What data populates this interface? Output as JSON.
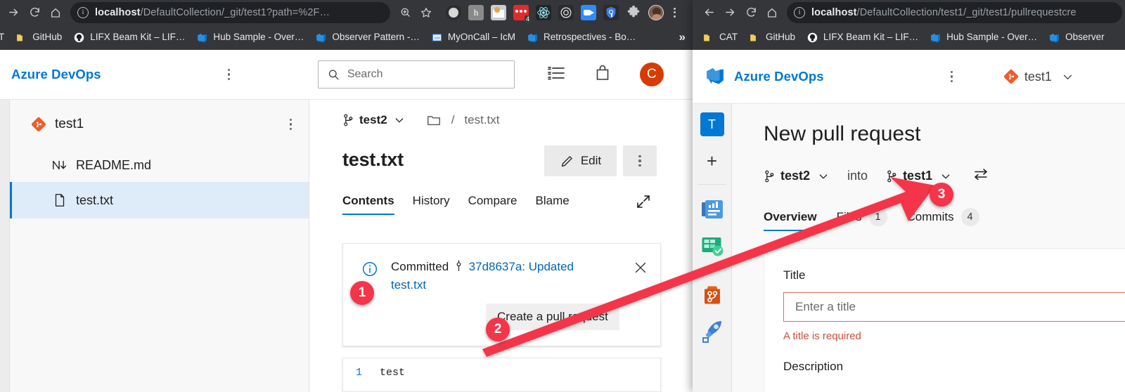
{
  "left_window": {
    "browser": {
      "nav": {
        "forward_icon": "arrow-right-icon",
        "reload_icon": "reload-icon",
        "home_icon": "home-icon"
      },
      "omnibox": {
        "info_icon": "site-info-icon",
        "url_host": "localhost",
        "url_path": "/DefaultCollection/_git/test1?path=%2F…",
        "zoom_icon": "zoom-in-icon",
        "bookmark_icon": "star-icon"
      },
      "extensions": [
        {
          "name": "grammar-extension-icon"
        },
        {
          "name": "honey-extension-icon"
        },
        {
          "name": "chrome-store-extension-icon"
        },
        {
          "name": "messaging-extension-icon",
          "badge": "4"
        },
        {
          "name": "react-devtools-extension-icon"
        },
        {
          "name": "target-extension-icon"
        },
        {
          "name": "video-extension-icon"
        },
        {
          "name": "password-extension-icon"
        },
        {
          "name": "puzzle-extensions-icon"
        }
      ],
      "profile_icon": "profile-avatar-icon",
      "menu_icon": "chrome-menu-icon",
      "bookmarks": [
        {
          "label": "AT",
          "icon": "folder-icon"
        },
        {
          "label": "GitHub",
          "icon": "folder-icon"
        },
        {
          "label": "LIFX Beam Kit – LIF…",
          "icon": "lifx-icon"
        },
        {
          "label": "Hub Sample - Over…",
          "icon": "azure-devops-icon"
        },
        {
          "label": "Observer Pattern -…",
          "icon": "azure-devops-icon"
        },
        {
          "label": "MyOnCall – IcM",
          "icon": "icm-icon"
        },
        {
          "label": "Retrospectives - Bo…",
          "icon": "azure-devops-icon"
        }
      ],
      "bookmarks_overflow": "»"
    },
    "header": {
      "brand": "Azure DevOps",
      "menu_icon": "more-options-icon",
      "search_placeholder": "Search",
      "search_icon": "search-icon",
      "work_items_icon": "work-items-icon",
      "marketplace_icon": "marketplace-bag-icon",
      "avatar_initial": "C",
      "avatar_color": "#d83b01"
    },
    "tree": {
      "repo_name": "test1",
      "repo_icon": "azure-repos-icon",
      "repo_menu_icon": "more-options-icon",
      "items": [
        {
          "label": "README.md",
          "icon": "markdown-icon",
          "selected": false
        },
        {
          "label": "test.txt",
          "icon": "file-icon",
          "selected": true
        }
      ]
    },
    "file_view": {
      "branch": "test2",
      "branch_icon": "branch-icon",
      "branch_chevron_icon": "chevron-down-icon",
      "folder_icon": "folder-icon",
      "path_separator": "/",
      "path_file": "test.txt",
      "title": "test.txt",
      "edit_label": "Edit",
      "edit_icon": "pencil-icon",
      "more_icon": "more-options-icon",
      "tabs": [
        {
          "label": "Contents",
          "active": true
        },
        {
          "label": "History",
          "active": false
        },
        {
          "label": "Compare",
          "active": false
        },
        {
          "label": "Blame",
          "active": false
        }
      ],
      "fullscreen_icon": "expand-icon"
    },
    "commit_message": {
      "info_icon": "info-icon",
      "text_prefix": "Committed",
      "commit_icon": "commit-icon",
      "commit_link": "37d8637a: Updated test.txt",
      "close_icon": "close-icon",
      "create_pr_label": "Create a pull request"
    },
    "code": {
      "line_number": "1",
      "line_text": "test"
    }
  },
  "right_window": {
    "browser": {
      "nav": {
        "back_icon": "arrow-left-icon",
        "forward_icon": "arrow-right-icon",
        "reload_icon": "reload-icon",
        "home_icon": "home-icon"
      },
      "omnibox": {
        "info_icon": "site-info-icon",
        "url_host": "localhost",
        "url_path": "/DefaultCollection/test1/_git/test1/pullrequestcre"
      },
      "bookmarks": [
        {
          "label": "CAT",
          "icon": "folder-icon"
        },
        {
          "label": "GitHub",
          "icon": "folder-icon"
        },
        {
          "label": "LIFX Beam Kit – LIF…",
          "icon": "lifx-icon"
        },
        {
          "label": "Hub Sample - Over…",
          "icon": "azure-devops-icon"
        },
        {
          "label": "Observer",
          "icon": "azure-devops-icon"
        }
      ]
    },
    "header": {
      "logo_icon": "azure-devops-logo-icon",
      "brand": "Azure DevOps",
      "menu_icon": "more-options-icon",
      "project_icon": "azure-repos-icon",
      "project_name": "test1",
      "project_chevron_icon": "chevron-down-icon"
    },
    "rail": [
      {
        "name": "project-avatar",
        "label": "T"
      },
      {
        "name": "new-item-icon",
        "label": "+"
      },
      {
        "name": "overview-icon",
        "label": ""
      },
      {
        "name": "boards-icon",
        "label": ""
      },
      {
        "name": "repos-icon",
        "label": ""
      },
      {
        "name": "pipelines-icon",
        "label": ""
      }
    ],
    "pr": {
      "title": "New pull request",
      "source_branch": "test2",
      "source_icon": "branch-icon",
      "source_chevron_icon": "chevron-down-icon",
      "into_label": "into",
      "target_branch": "test1",
      "target_icon": "branch-icon",
      "target_chevron_icon": "chevron-down-icon",
      "swap_icon": "swap-branches-icon",
      "tabs": [
        {
          "label": "Overview",
          "count": "",
          "active": true
        },
        {
          "label": "Files",
          "count": "1",
          "active": false
        },
        {
          "label": "Commits",
          "count": "4",
          "active": false
        }
      ],
      "title_label": "Title",
      "title_placeholder": "Enter a title",
      "title_error": "A title is required",
      "description_label": "Description"
    }
  },
  "annotations": {
    "accent_color": "#f4354a",
    "steps": [
      {
        "number": "1",
        "name": "step-1-badge"
      },
      {
        "number": "2",
        "name": "step-2-badge"
      },
      {
        "number": "3",
        "name": "step-3-badge"
      }
    ],
    "arrow": {
      "name": "callout-arrow",
      "color": "#f4354a"
    }
  }
}
